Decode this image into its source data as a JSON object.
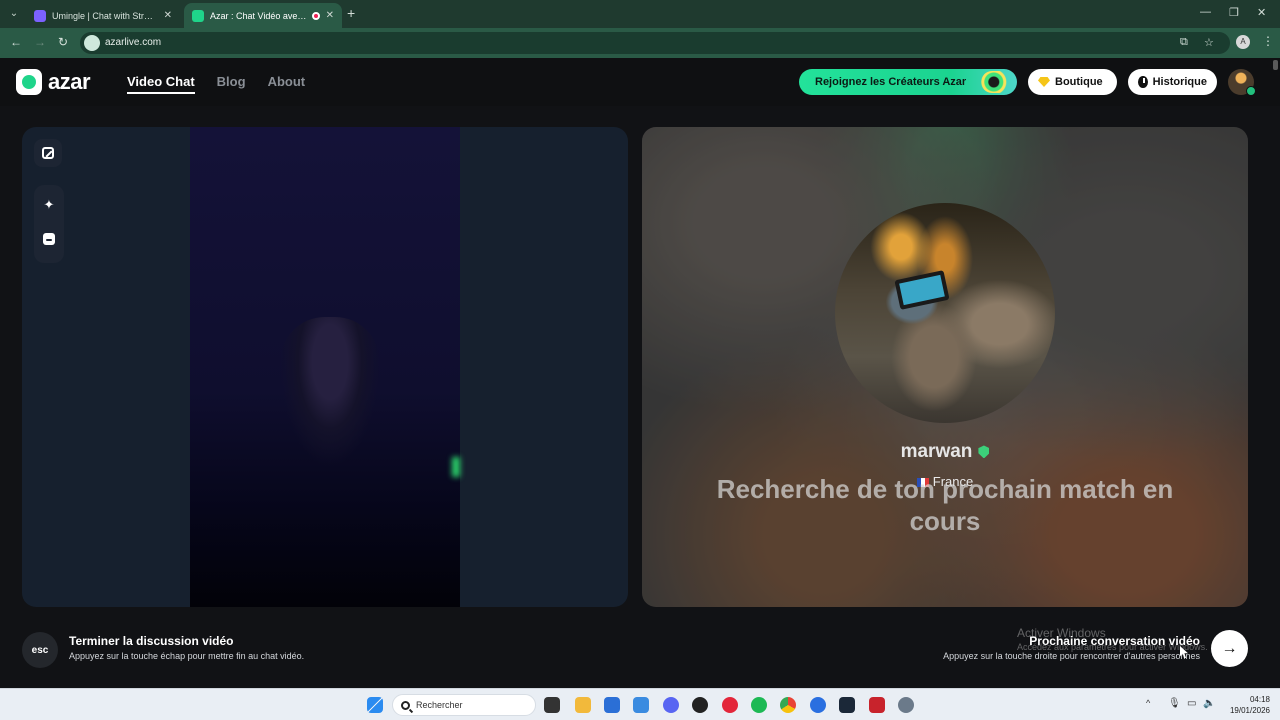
{
  "browser": {
    "tabs": [
      {
        "title": "Umingle | Chat with Strangers Nov...",
        "favicon_color": "#7b61ff",
        "active": false
      },
      {
        "title": "Azar : Chat Vidéo avec de nouve...",
        "favicon_color": "#1fd48a",
        "active": true
      }
    ],
    "url": "azarlive.com",
    "profile_initial": "A"
  },
  "site": {
    "logo_text": "azar",
    "nav": [
      {
        "label": "Video Chat",
        "active": true
      },
      {
        "label": "Blog",
        "active": false
      },
      {
        "label": "About",
        "active": false
      }
    ],
    "creator_button": "Rejoignez les Créateurs Azar",
    "shop_button": "Boutique",
    "history_button": "Historique",
    "accent_color": "#1fd48a"
  },
  "self_panel": {
    "tools": [
      "expand-icon",
      "magic-wand-icon",
      "face-filter-icon"
    ]
  },
  "match": {
    "name": "marwan",
    "country": "France",
    "status": "Recherche de ton prochain match en cours"
  },
  "footer": {
    "esc_key": "esc",
    "end_title": "Terminer la discussion vidéo",
    "end_desc": "Appuyez sur la touche échap pour mettre fin au chat vidéo.",
    "next_title": "Prochaine conversation vidéo",
    "next_desc": "Appuyez sur la touche droite pour rencontrer d'autres personnes",
    "next_arrow": "→"
  },
  "windows_watermark": {
    "title": "Activer Windows",
    "subtitle": "Accédez aux paramètres pour activer Windows."
  },
  "taskbar": {
    "search_placeholder": "Rechercher",
    "time": "04:18",
    "date": "19/01/2026"
  }
}
